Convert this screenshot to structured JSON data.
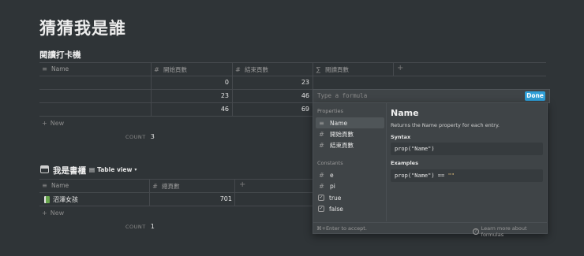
{
  "page": {
    "title": "猜猜我是誰"
  },
  "db1": {
    "title": "閱讀打卡機",
    "columns": [
      {
        "icon": "name-icon",
        "label": "Name"
      },
      {
        "icon": "number-icon",
        "label": "開始頁數"
      },
      {
        "icon": "number-icon",
        "label": "結束頁數"
      },
      {
        "icon": "sigma-icon",
        "label": "閱讀頁數"
      }
    ],
    "rows": [
      {
        "start": "0",
        "end": "23"
      },
      {
        "start": "23",
        "end": "46"
      },
      {
        "start": "46",
        "end": "69"
      }
    ],
    "new_label": "New",
    "count_label": "COUNT",
    "count_value": "3"
  },
  "db2": {
    "title": "我是書櫃",
    "view_label": "Table view",
    "columns": [
      {
        "icon": "name-icon",
        "label": "Name"
      },
      {
        "icon": "number-icon",
        "label": "總頁數"
      }
    ],
    "rows": [
      {
        "name": "沼澤女孩",
        "pages": "701"
      }
    ],
    "new_label": "New",
    "count_label": "COUNT",
    "count_value": "1"
  },
  "formula": {
    "placeholder": "Type a formula",
    "done_label": "Done",
    "properties_header": "Properties",
    "properties": [
      "Name",
      "開始頁數",
      "結束頁數"
    ],
    "constants_header": "Constants",
    "constants": [
      "e",
      "pi",
      "true",
      "false"
    ],
    "detail_title": "Name",
    "detail_desc": "Returns the Name property for each entry.",
    "syntax_label": "Syntax",
    "syntax_code": "prop(\"Name\")",
    "examples_label": "Examples",
    "example_prefix": "prop(\"Name\") == ",
    "example_str": "\"\"",
    "footer_left": "⌘+Enter to accept.",
    "footer_right": "Learn more about formulas"
  },
  "colors": {
    "background": "#2f3437",
    "accent": "#2e9fd8"
  }
}
